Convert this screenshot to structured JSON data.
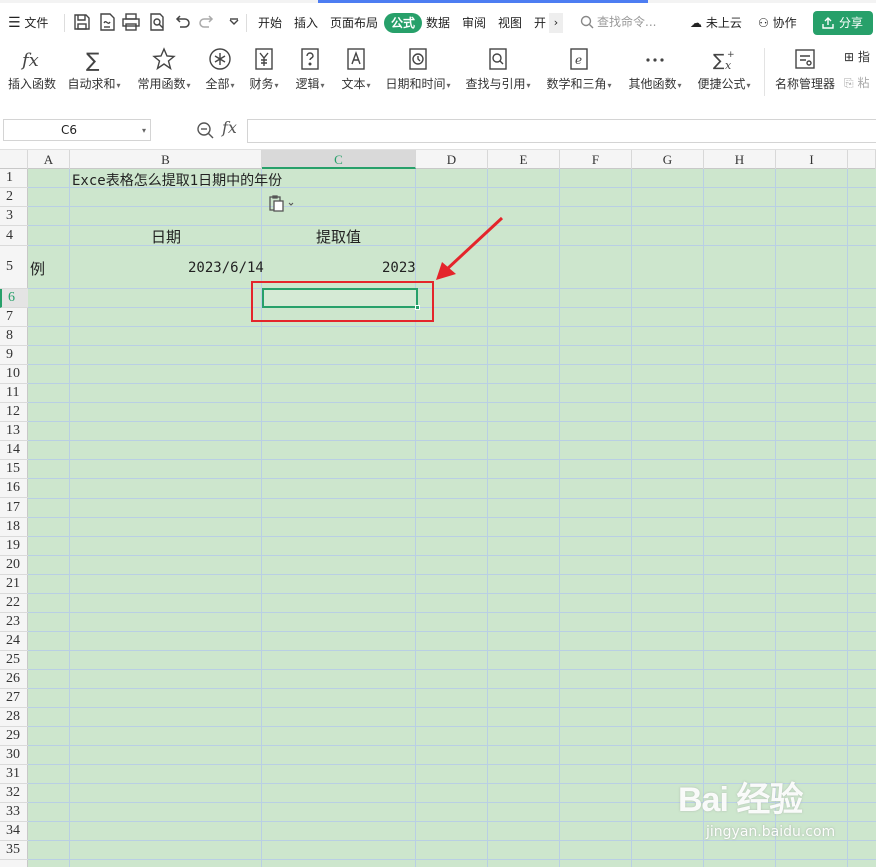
{
  "menubar": {
    "file_label": "文件",
    "tabs": [
      "开始",
      "插入",
      "页面布局",
      "公式",
      "数据",
      "审阅",
      "视图",
      "开"
    ],
    "active_tab": "公式",
    "search_placeholder": "查找命令...",
    "cloud_label": "未上云",
    "collab_label": "协作",
    "share_label": "分享"
  },
  "ribbon": {
    "items": [
      {
        "label": "插入函数",
        "icon": "fx-icon",
        "dropdown": false
      },
      {
        "label": "自动求和",
        "icon": "sigma-icon",
        "dropdown": true
      },
      {
        "label": "常用函数",
        "icon": "star-icon",
        "dropdown": true
      },
      {
        "label": "全部",
        "icon": "asterisk-circle-icon",
        "dropdown": true
      },
      {
        "label": "财务",
        "icon": "yen-icon",
        "dropdown": true
      },
      {
        "label": "逻辑",
        "icon": "question-box-icon",
        "dropdown": true
      },
      {
        "label": "文本",
        "icon": "text-a-icon",
        "dropdown": true
      },
      {
        "label": "日期和时间",
        "icon": "clock-icon",
        "dropdown": true
      },
      {
        "label": "查找与引用",
        "icon": "search-box-icon",
        "dropdown": true
      },
      {
        "label": "数学和三角",
        "icon": "theta-icon",
        "dropdown": true
      },
      {
        "label": "其他函数",
        "icon": "more-dots-icon",
        "dropdown": true
      },
      {
        "label": "便捷公式",
        "icon": "sigma-x-icon",
        "dropdown": true
      },
      {
        "label": "名称管理器",
        "icon": "name-manager-icon",
        "dropdown": false
      }
    ],
    "right_small": [
      "指",
      "粘"
    ]
  },
  "formula_bar": {
    "name_box": "C6",
    "fx_label": "fx",
    "formula_value": ""
  },
  "sheet": {
    "columns": [
      "A",
      "B",
      "C",
      "D",
      "E",
      "F",
      "G",
      "H",
      "I"
    ],
    "selected_column": "C",
    "rows": [
      "1",
      "2",
      "3",
      "4",
      "5",
      "6",
      "7",
      "8",
      "9",
      "10",
      "11",
      "12",
      "13",
      "14",
      "15",
      "16",
      "17",
      "18",
      "19",
      "20",
      "21",
      "22",
      "23",
      "24",
      "25",
      "26",
      "27",
      "28",
      "29",
      "30",
      "31",
      "32",
      "33",
      "34",
      "35"
    ],
    "selected_row": "6",
    "cells": {
      "B1": "Exce表格怎么提取1日期中的年份",
      "B4": "日期",
      "C4": "提取值",
      "A5": "例",
      "B5": "2023/6/14",
      "C5": "2023"
    },
    "active_cell": "C6",
    "grid_color": "#b9cfe4",
    "background_color": "#cde6cd"
  },
  "annotation": {
    "color": "#e4252b"
  },
  "watermark": {
    "brand": "Bai  经验",
    "url": "jingyan.baidu.com"
  },
  "colors": {
    "accent": "#27a06a"
  }
}
